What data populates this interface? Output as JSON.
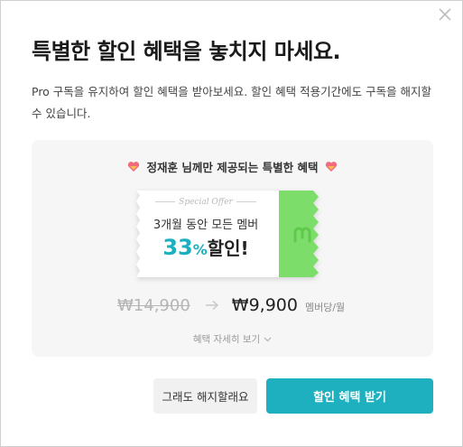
{
  "dialog": {
    "title": "특별한 할인 혜택을 놓치지 마세요.",
    "description": "Pro 구독을 유지하여 할인 혜택을 받아보세요. 할인 혜택 적용기간에도 구독을 해지할 수 있습니다."
  },
  "offer": {
    "heading": "정재훈 님께만 제공되는 특별한 혜택",
    "ticket": {
      "special_label": "Special Offer",
      "line1": "3개월 동안 모든 멤버",
      "discount_number": "33",
      "discount_symbol": "%",
      "discount_word": "할인!"
    },
    "old_price": "₩14,900",
    "new_price": "₩9,900",
    "price_unit": "멤버당/월",
    "detail_link": "혜택 자세히 보기"
  },
  "buttons": {
    "cancel_label": "그래도 해지할래요",
    "accept_label": "할인 혜택 받기"
  },
  "colors": {
    "accent": "#1fb0bf",
    "ticket_stub": "#7ddd6a",
    "card_bg": "#f6f6f6"
  },
  "icons": {
    "close": "close-icon",
    "heart": "heart-icon",
    "arrow": "arrow-right-icon",
    "chevron": "chevron-down-icon",
    "stub_logo": "m-logo-icon"
  }
}
